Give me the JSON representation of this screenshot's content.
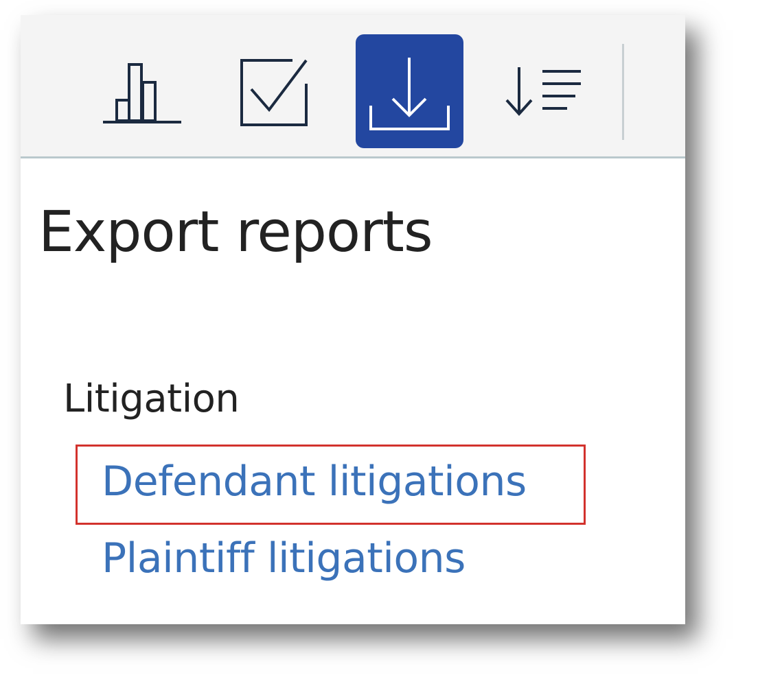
{
  "toolbar": {
    "buttons": [
      {
        "icon": "bar-chart-icon",
        "label": "",
        "active": false
      },
      {
        "icon": "checkbox-icon",
        "label": "",
        "active": false
      },
      {
        "icon": "download-icon",
        "label": "",
        "active": true
      },
      {
        "icon": "sort-descending-icon",
        "label": "",
        "active": false
      }
    ],
    "active_color": "#2347a0",
    "icon_color": "#1b2a40"
  },
  "page": {
    "title": "Export reports"
  },
  "section": {
    "label": "Litigation",
    "links": [
      {
        "label": "Defendant litigations",
        "highlighted": true
      },
      {
        "label": "Plaintiff litigations",
        "highlighted": false
      }
    ],
    "link_color": "#3b72b9",
    "highlight_color": "#d2322d"
  }
}
